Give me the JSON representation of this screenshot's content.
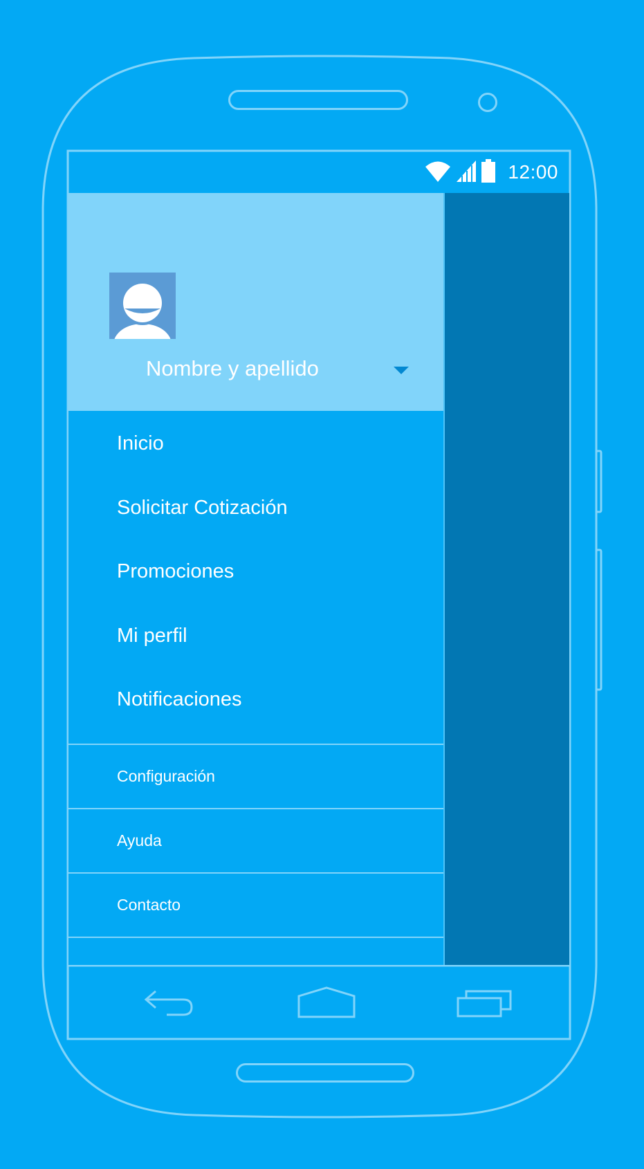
{
  "status_bar": {
    "time": "12:00",
    "icons": [
      "wifi-icon",
      "signal-icon",
      "battery-icon"
    ]
  },
  "drawer": {
    "account": {
      "name": "Nombre y apellido",
      "avatar_icon": "avatar-icon",
      "dropdown_icon": "caret-down-icon"
    },
    "primary_items": [
      {
        "label": "Inicio"
      },
      {
        "label": "Solicitar Cotización"
      },
      {
        "label": "Promociones"
      },
      {
        "label": "Mi perfil"
      },
      {
        "label": "Notificaciones"
      }
    ],
    "secondary_items": [
      {
        "label": "Configuración"
      },
      {
        "label": "Ayuda"
      },
      {
        "label": "Contacto"
      }
    ]
  },
  "nav_bar": {
    "icons": [
      "back-icon",
      "home-icon",
      "recents-icon"
    ]
  },
  "colors": {
    "background": "#03A9F4",
    "drawer_header": "#81D4FA",
    "scrim": "#0277B3",
    "outline": "#81D4FA",
    "avatar_bg": "#5B9BD5",
    "dropdown": "#0288D1"
  }
}
